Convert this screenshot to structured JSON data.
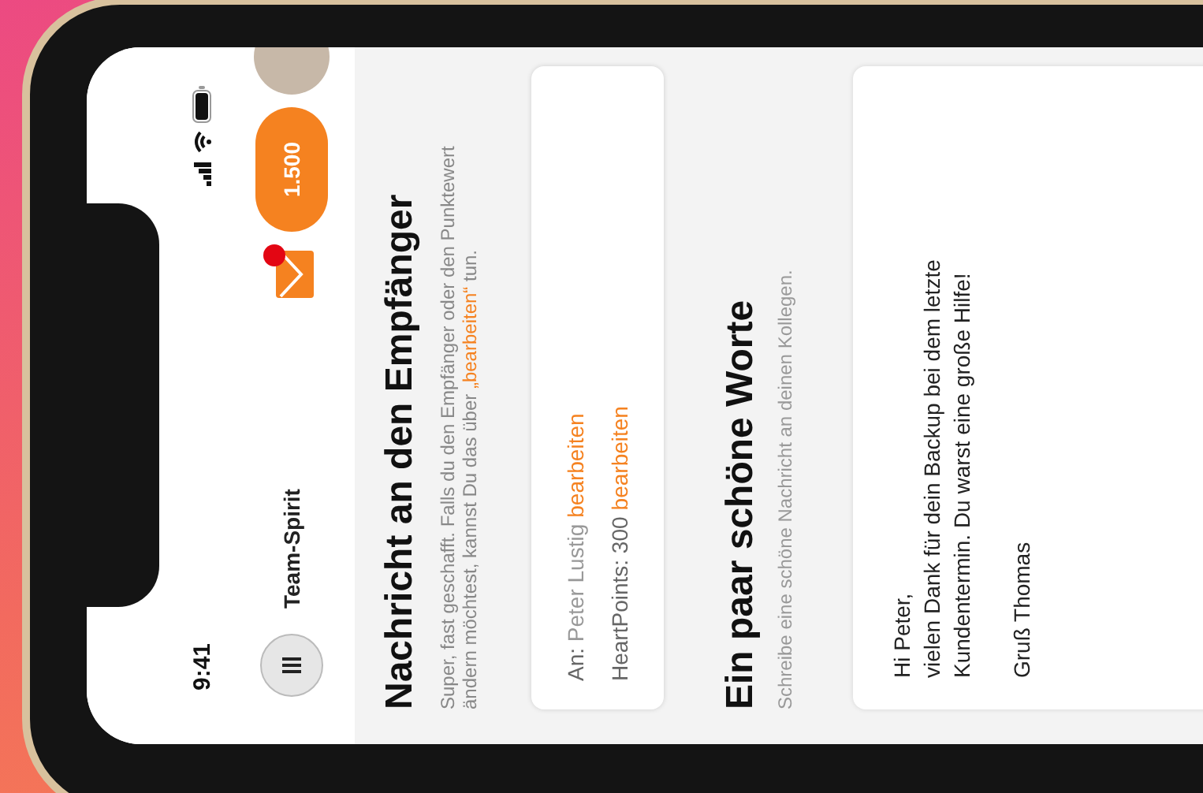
{
  "status_bar": {
    "time": "9:41"
  },
  "header": {
    "title": "Team-Spirit",
    "mail_unread": true,
    "points": "1.500"
  },
  "recipient_section": {
    "title": "Nachricht an den Empfänger",
    "description": "Super, fast geschafft. Falls du den Empfänger oder den Punktewert ändern möchtest, kannst Du das über",
    "description_link": "„bearbeiten“",
    "description_end": "tun.",
    "details": [
      {
        "label": "An:",
        "value": "Peter Lustig",
        "link": "bearbeiten"
      },
      {
        "label": "HeartPoints:",
        "value": "300",
        "link": "bearbeiten"
      }
    ]
  },
  "message_section": {
    "title": "Ein paar schöne Worte",
    "description": "Schreibe eine schöne Nachricht an deinen Kollegen.",
    "message": {
      "value": "Hi Peter,\nvielen Dank für dein Backup bei dem letzte Kundentermin. Du warst eine große Hilfe!\n\nGruß Thomas"
    }
  }
}
